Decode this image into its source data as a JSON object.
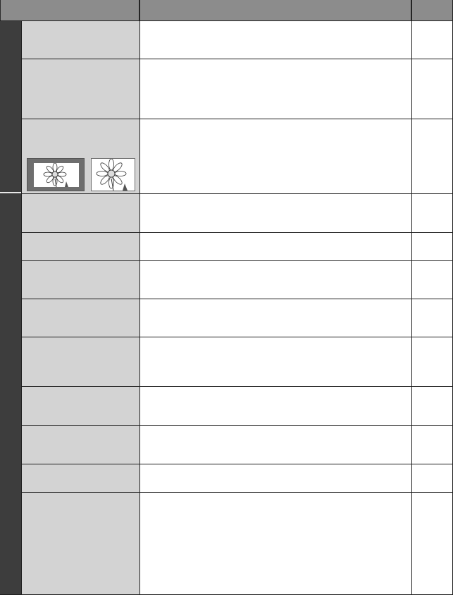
{
  "table": {
    "header": {
      "col_item": "",
      "col_description": "",
      "col_page": ""
    },
    "categories": [
      {
        "label": ""
      },
      {
        "label": ""
      }
    ],
    "rows": [
      {
        "item": "",
        "description": "",
        "page": ""
      },
      {
        "item": "",
        "description": "",
        "page": ""
      },
      {
        "item": "",
        "description": "",
        "page": "",
        "thumbnails": [
          "flower-thumbnail-framed-icon",
          "flower-thumbnail-full-icon"
        ]
      },
      {
        "item": "",
        "description": "",
        "page": ""
      },
      {
        "item": "",
        "description": "",
        "page": ""
      },
      {
        "item": "",
        "description": "",
        "page": ""
      },
      {
        "item": "",
        "description": "",
        "page": ""
      },
      {
        "item": "",
        "description": "",
        "page": ""
      },
      {
        "item": "",
        "description": "",
        "page": ""
      },
      {
        "item": "",
        "description": "",
        "page": ""
      },
      {
        "item": "",
        "description": "",
        "page": ""
      },
      {
        "item": "",
        "description": "",
        "page": ""
      }
    ]
  },
  "colors": {
    "header": "#8c8c8c",
    "category_strip": "#3d3d3d",
    "item_cell": "#d3d3d3",
    "grid": "#1f1f1f"
  }
}
